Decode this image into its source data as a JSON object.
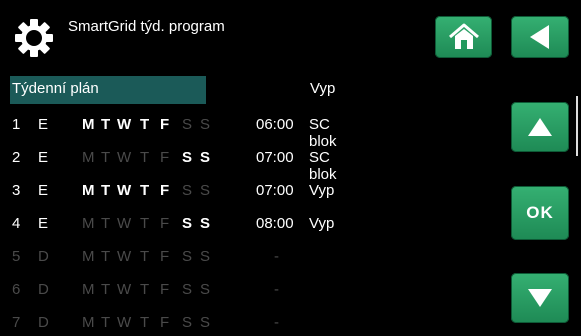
{
  "header": {
    "title": "SmartGrid týd. program"
  },
  "icons": {
    "gear": "gear-icon",
    "home": "home-icon",
    "back": "back-arrow-icon",
    "up": "up-arrow-icon",
    "down": "down-arrow-icon"
  },
  "colors": {
    "button_green": "#2aa065",
    "header_highlight": "#1b5a58",
    "disabled_text": "#4a4a4a"
  },
  "buttons": {
    "ok_label": "OK"
  },
  "table": {
    "header_label": "Týdenní plán",
    "header_mode": "Vyp",
    "rows": [
      {
        "num": "1",
        "type": "E",
        "days": [
          "M",
          "T",
          "W",
          "T",
          "F",
          "S",
          "S"
        ],
        "active": [
          true,
          true,
          true,
          true,
          true,
          false,
          false
        ],
        "time": "06:00",
        "mode": "SC blok",
        "enabled": true
      },
      {
        "num": "2",
        "type": "E",
        "days": [
          "M",
          "T",
          "W",
          "T",
          "F",
          "S",
          "S"
        ],
        "active": [
          false,
          false,
          false,
          false,
          false,
          true,
          true
        ],
        "time": "07:00",
        "mode": "SC blok",
        "enabled": true
      },
      {
        "num": "3",
        "type": "E",
        "days": [
          "M",
          "T",
          "W",
          "T",
          "F",
          "S",
          "S"
        ],
        "active": [
          true,
          true,
          true,
          true,
          true,
          false,
          false
        ],
        "time": "07:00",
        "mode": "Vyp",
        "enabled": true
      },
      {
        "num": "4",
        "type": "E",
        "days": [
          "M",
          "T",
          "W",
          "T",
          "F",
          "S",
          "S"
        ],
        "active": [
          false,
          false,
          false,
          false,
          false,
          true,
          true
        ],
        "time": "08:00",
        "mode": "Vyp",
        "enabled": true
      },
      {
        "num": "5",
        "type": "D",
        "days": [
          "M",
          "T",
          "W",
          "T",
          "F",
          "S",
          "S"
        ],
        "active": [
          false,
          false,
          false,
          false,
          false,
          false,
          false
        ],
        "time": "-",
        "mode": "",
        "enabled": false
      },
      {
        "num": "6",
        "type": "D",
        "days": [
          "M",
          "T",
          "W",
          "T",
          "F",
          "S",
          "S"
        ],
        "active": [
          false,
          false,
          false,
          false,
          false,
          false,
          false
        ],
        "time": "-",
        "mode": "",
        "enabled": false
      },
      {
        "num": "7",
        "type": "D",
        "days": [
          "M",
          "T",
          "W",
          "T",
          "F",
          "S",
          "S"
        ],
        "active": [
          false,
          false,
          false,
          false,
          false,
          false,
          false
        ],
        "time": "-",
        "mode": "",
        "enabled": false
      }
    ]
  }
}
